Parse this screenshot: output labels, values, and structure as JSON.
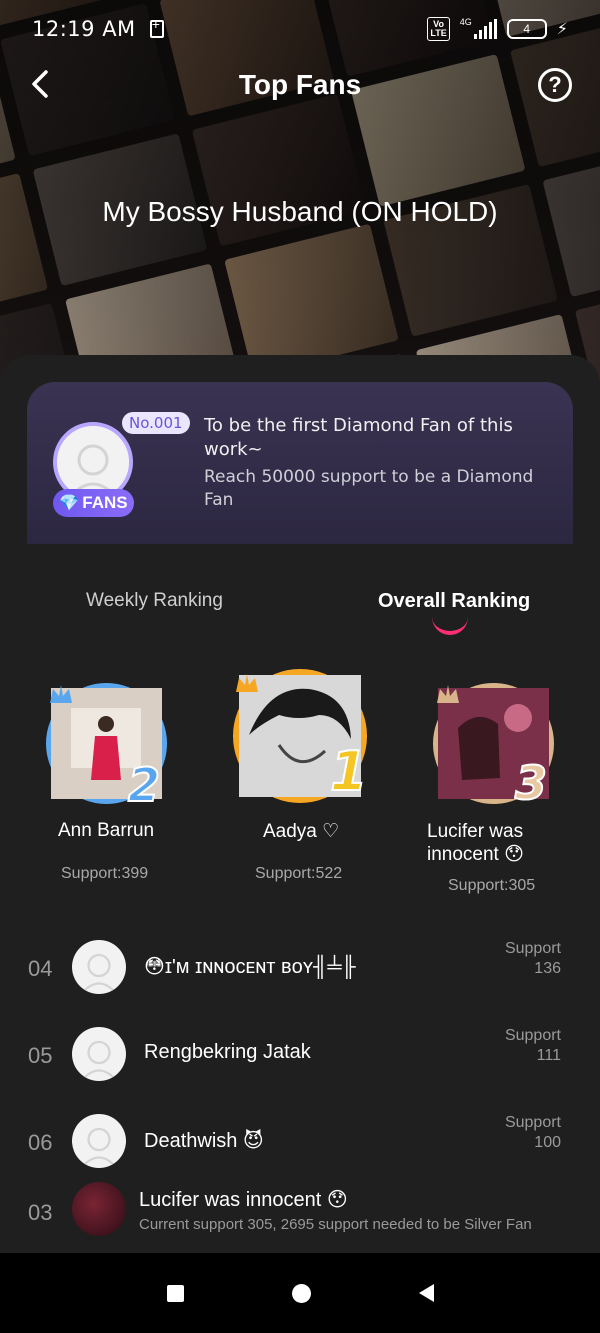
{
  "status_bar": {
    "time": "12:19 AM",
    "volte": "Vo LTE",
    "network": "4G",
    "battery": "4"
  },
  "nav": {
    "title": "Top Fans",
    "help_label": "?"
  },
  "book": {
    "title": "My Bossy Husband (ON HOLD)"
  },
  "diamond": {
    "badge_number": "No.001",
    "fans_label": "FANS",
    "line1": "To be the first Diamond Fan of this work~",
    "line2": "Reach 50000 support to be a Diamond Fan"
  },
  "tabs": {
    "weekly": "Weekly Ranking",
    "overall": "Overall Ranking",
    "active": "overall"
  },
  "podium": [
    {
      "rank": "2",
      "name": "Ann Barrun",
      "support": "Support:399"
    },
    {
      "rank": "1",
      "name": "Aadya ♡",
      "support": "Support:522"
    },
    {
      "rank": "3",
      "name": "Lucifer was innocent 😯",
      "support": "Support:305"
    }
  ],
  "ranking_list": [
    {
      "rank": "04",
      "name": "😳ɪ'ᴍ ɪɴɴᴏᴄᴇɴᴛ ʙᴏʏ╢╧╟",
      "support_label": "Support",
      "support_value": "136"
    },
    {
      "rank": "05",
      "name": "Rengbekring Jatak",
      "support_label": "Support",
      "support_value": "111"
    },
    {
      "rank": "06",
      "name": "Deathwish 😈",
      "support_label": "Support",
      "support_value": "100"
    }
  ],
  "my_rank": {
    "rank": "03",
    "name": "Lucifer was innocent 😯",
    "note": "Current support 305, 2695 support needed to be Silver Fan"
  },
  "colors": {
    "accent": "#ff2f73",
    "panel": "#1f1f1f",
    "diamond_card": "#332c49",
    "gold": "#f5a623",
    "silver_blue": "#5aa6ee",
    "bronze": "#d9b48a"
  }
}
